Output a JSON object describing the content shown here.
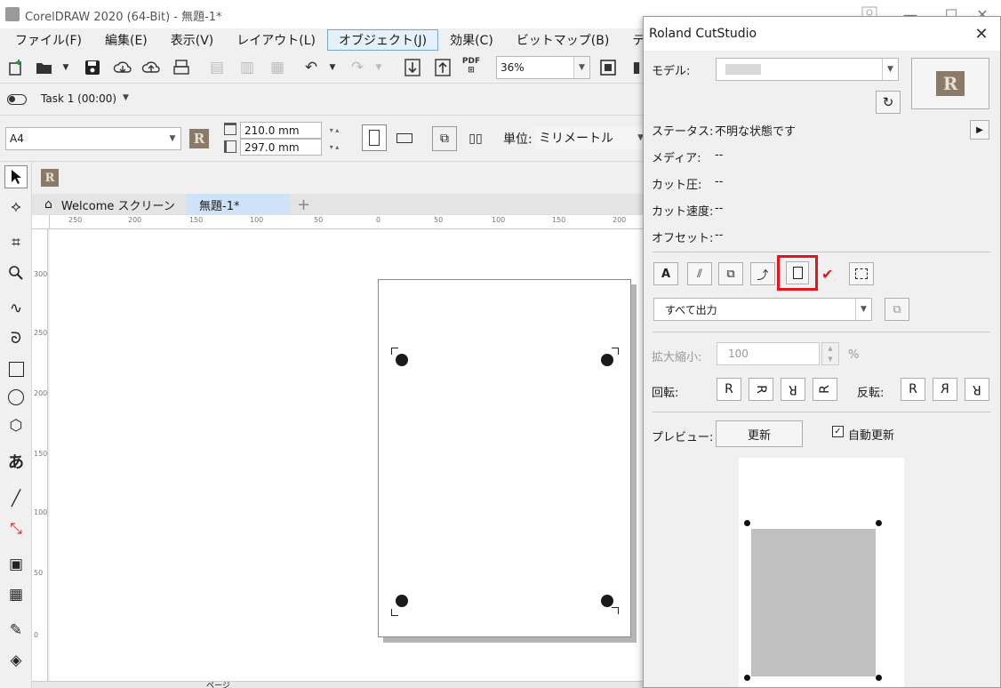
{
  "window": {
    "title": "CorelDRAW 2020 (64-Bit) - 無題-1*",
    "controls": [
      "—",
      "☐",
      "✕"
    ]
  },
  "menu": [
    {
      "label": "ファイル(F)"
    },
    {
      "label": "編集(E)"
    },
    {
      "label": "表示(V)"
    },
    {
      "label": "レイアウト(L)"
    },
    {
      "label": "オブジェクト(J)",
      "active": true
    },
    {
      "label": "効果(C)"
    },
    {
      "label": "ビットマップ(B)"
    },
    {
      "label": "テキスト(X)"
    }
  ],
  "toolbar": {
    "zoom": "36%",
    "pdf_label": "PDF"
  },
  "task_bar": {
    "task": "Task 1 (00:00)"
  },
  "property_bar": {
    "page_size": "A4",
    "width": "210.0 mm",
    "height": "297.0 mm",
    "unit_label": "単位:",
    "unit_value": "ミリメートル"
  },
  "tabs": {
    "welcome": "Welcome スクリーン",
    "document": "無題-1*",
    "add": "+"
  },
  "rulers": {
    "horizontal": [
      "250",
      "200",
      "150",
      "100",
      "50",
      "0",
      "50",
      "100",
      "150",
      "200"
    ],
    "vertical": [
      "300",
      "250",
      "200",
      "150",
      "100",
      "50",
      "0"
    ]
  },
  "status_bar": {
    "page_label": "ページ"
  },
  "dialog": {
    "title": "Roland CutStudio",
    "close": "✕",
    "model_label": "モデル:",
    "model_value": "",
    "status_label": "ステータス:",
    "status_value": "不明な状態です",
    "media_label": "メディア:",
    "media_value": "--",
    "cut_pressure_label": "カット圧:",
    "cut_pressure_value": "--",
    "cut_speed_label": "カット速度:",
    "cut_speed_value": "--",
    "offset_label": "オフセット:",
    "offset_value": "--",
    "output_value": "すべて出力",
    "scale_label": "拡大縮小:",
    "scale_value": "100",
    "scale_unit": "%",
    "rotate_label": "回転:",
    "mirror_label": "反転:",
    "rotate_buttons": [
      "R",
      "R",
      "R",
      "R"
    ],
    "mirror_buttons": [
      "R",
      "R",
      "R"
    ],
    "preview_label": "プレビュー:",
    "update_button": "更新",
    "auto_update_label": "自動更新",
    "auto_update_checked": true,
    "highlight_color": "#e8141c"
  }
}
